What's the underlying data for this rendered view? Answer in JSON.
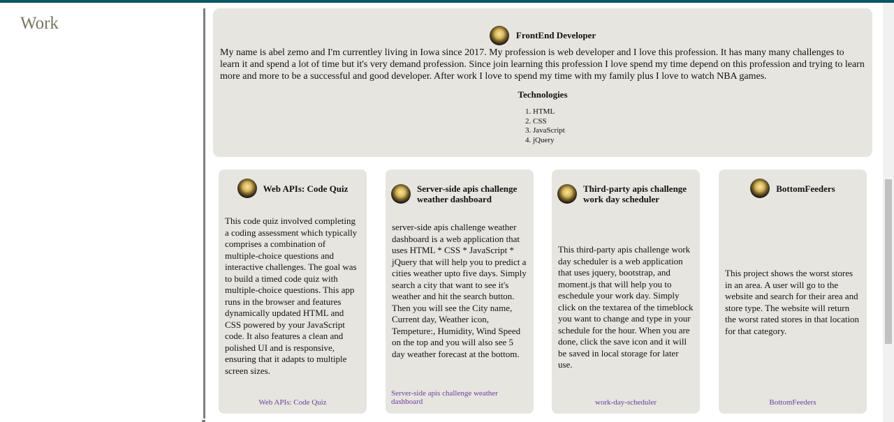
{
  "sidebar": {
    "title": "Work"
  },
  "profile": {
    "title": "FrontEnd Developer",
    "bio": "My name is abel zemo and I'm currentley living in Iowa since 2017. My profession is web developer and I love this profession. It has many many challenges to learn it and spend a lot of time but it's very demand profession. Since join learning this profession I love spend my time depend on this profession and trying to learn more and more to be a successful and good developer. After work I love to spend my time with my family plus I love to watch NBA games.",
    "technologies_title": "Technologies",
    "technologies": [
      "1. HTML",
      "2. CSS",
      "3. JavaScript",
      "4. jQuery"
    ]
  },
  "projects": [
    {
      "title": "Web APIs: Code Quiz",
      "description": "This code quiz involved completing a coding assessment which typically comprises a combination of multiple-choice questions and interactive challenges. The goal was to build a timed code quiz with multiple-choice questions. This app runs in the browser and features dynamically updated HTML and CSS powered by your JavaScript code. It also features a clean and polished UI and is responsive, ensuring that it adapts to multiple screen sizes.",
      "link": "Web APIs: Code Quiz"
    },
    {
      "title": "Server-side apis challenge weather dashboard",
      "description": "server-side apis challenge weather dashboard is a web application that uses HTML * CSS * JavaScript * jQuery that will help you to predict a cities weather upto five days. Simply search a city that want to see it's weather and hit the search button. Then you will see the City name, Current day, Weather icon, Tempeture:, Humidity, Wind Speed on the top and you will also see 5 day weather forecast at the bottom.",
      "link": "Server-side apis challenge weather dashboard"
    },
    {
      "title": "Third-party apis challenge work day scheduler",
      "description": "This third-party apis challenge work day scheduler is a web application that uses jquery, bootstrap, and moment.js that will help you to eschedule your work day. Simply click on the textarea of the timeblock you want to change and type in your schedule for the hour. When you are done, click the save icon and it will be saved in local storage for later use.",
      "link": "work-day-scheduler"
    },
    {
      "title": "BottomFeeders",
      "description": "This project shows the worst stores in an area. A user will go to the website and search for their area and store type. The website will return the worst rated stores in that location for that category.",
      "link": "BottomFeeders"
    }
  ]
}
